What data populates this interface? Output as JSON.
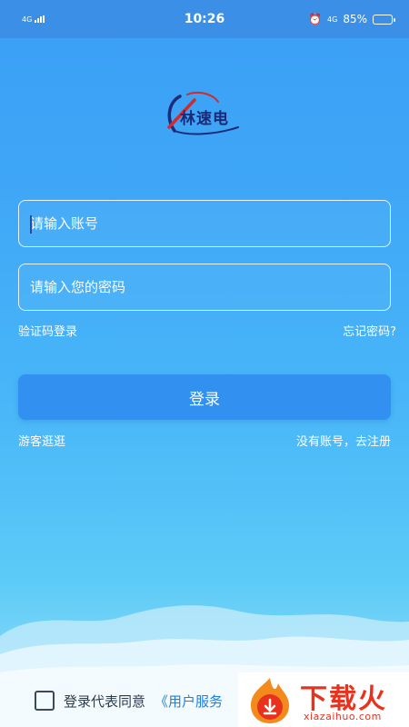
{
  "status_bar": {
    "network_left": "4G",
    "time": "10:26",
    "network_right": "4G",
    "battery_percent": "85%",
    "battery_level": 0.85
  },
  "logo": {
    "text": "林速电",
    "icon": "orbit-logo-icon"
  },
  "account_field": {
    "placeholder": "请输入账号",
    "value": ""
  },
  "password_field": {
    "placeholder": "请输入您的密码",
    "value": ""
  },
  "links": {
    "sms_login": "验证码登录",
    "forgot_password": "忘记密码?",
    "guest": "游客逛逛",
    "register": "没有账号，去注册"
  },
  "login_button": {
    "label": "登录"
  },
  "agreement": {
    "text": "登录代表同意",
    "link": "《用户服务",
    "checked": false
  },
  "watermark": {
    "title": "下载火",
    "subtitle": "xiazaihuo.com"
  },
  "colors": {
    "primary": "#3190f0",
    "status_bar": "#3b8fe6",
    "watermark": "#e8321e"
  }
}
